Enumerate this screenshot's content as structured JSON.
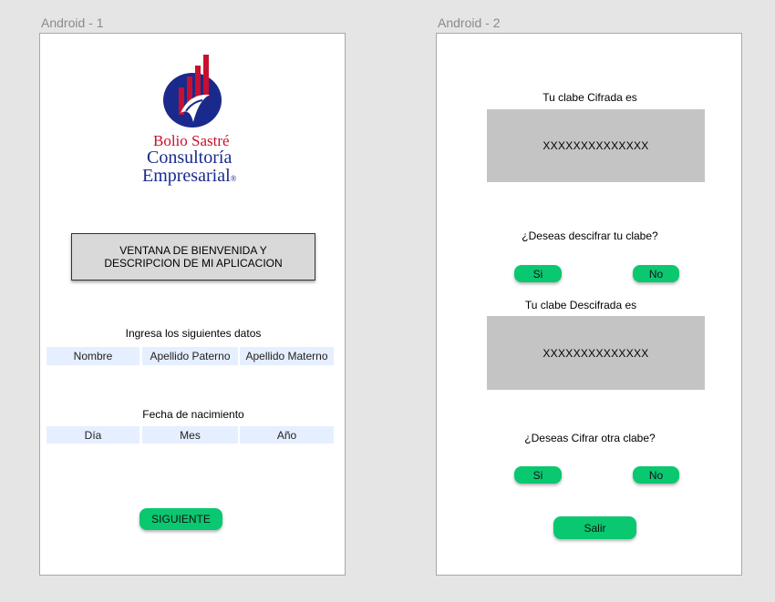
{
  "frames": {
    "android1_label": "Android - 1",
    "android2_label": "Android - 2"
  },
  "screen1": {
    "logo": {
      "line1": "Bolio Sastré",
      "line2": "Consultoría",
      "line3": "Empresarial",
      "registered_mark": "®"
    },
    "welcome_text": "VENTANA DE BIENVENIDA Y DESCRIPCION DE MI APLICACION",
    "data_heading": "Ingresa los siguientes datos",
    "name_fields": [
      "Nombre",
      "Apellido Paterno",
      "Apellido Materno"
    ],
    "dob_heading": "Fecha de nacimiento",
    "dob_fields": [
      "Día",
      "Mes",
      "Año"
    ],
    "next_button": "SIGUIENTE"
  },
  "screen2": {
    "cipher_label": "Tu clabe  Cifrada es",
    "cipher_value": "XXXXXXXXXXXXXX",
    "decrypt_question": "¿Deseas descifrar tu clabe?",
    "yes1": "Si",
    "no1": "No",
    "decipher_label": "Tu clabe  Descifrada es",
    "decipher_value": "XXXXXXXXXXXXXX",
    "encrypt_again_question": "¿Deseas Cifrar otra clabe?",
    "yes2": "Si",
    "no2": "No",
    "exit_button": "Salir"
  },
  "colors": {
    "button_green": "#0ac870",
    "field_blue": "#e6efff",
    "gray_box": "#c4c4c4",
    "logo_red": "#c8102e",
    "logo_navy": "#1a2a8c"
  }
}
